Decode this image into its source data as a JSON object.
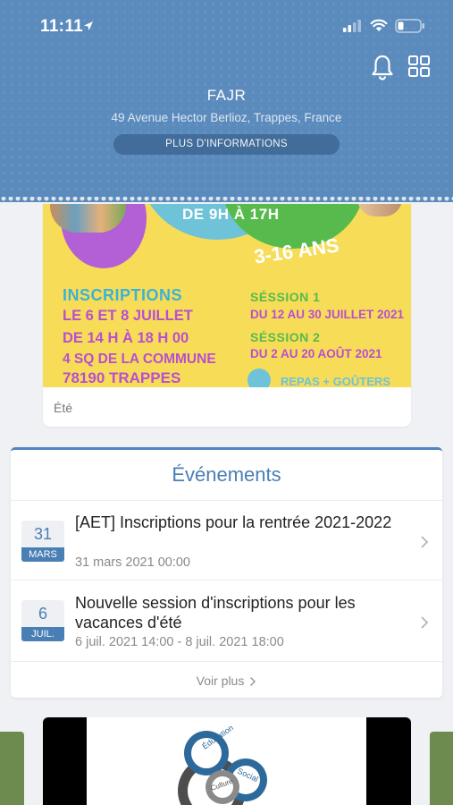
{
  "status_bar": {
    "time": "11:11"
  },
  "header": {
    "org_name": "FAJR",
    "address": "49 Avenue Hector Berlioz, Trappes, France",
    "info_button": "PLUS D'INFORMATIONS"
  },
  "poster": {
    "hours": "DE 9H À 17H",
    "age": "3-16 ANS",
    "inscriptions_title": "INSCRIPTIONS",
    "inscriptions_dates": "LE 6 ET 8 JUILLET",
    "inscriptions_hours": "DE 14 H À 18 H 00",
    "address_line": "4 SQ DE LA COMMUNE",
    "postcode": "78190 TRAPPES",
    "session1_title": "SÉSSION 1",
    "session1_dates": "DU 12 AU 30 JUILLET 2021",
    "session2_title": "SÉSSION 2",
    "session2_dates": "DU 2 AU 20 AOÛT 2021",
    "meals": "REPAS + GOÛTERS",
    "caption": "Été"
  },
  "events": {
    "title": "Événements",
    "items": [
      {
        "day": "31",
        "month": "MARS",
        "title": "[AET] Inscriptions pour la rentrée 2021-2022",
        "date": "31 mars 2021 00:00"
      },
      {
        "day": "6",
        "month": "JUIL.",
        "title": "Nouvelle session d'inscriptions pour les vacances d'été",
        "date": "6 juil. 2021 14:00 - 8 juil. 2021 18:00"
      }
    ],
    "see_more": "Voir plus"
  },
  "carousel": {
    "logo_words": [
      "Éducation",
      "Social",
      "Culture"
    ]
  }
}
